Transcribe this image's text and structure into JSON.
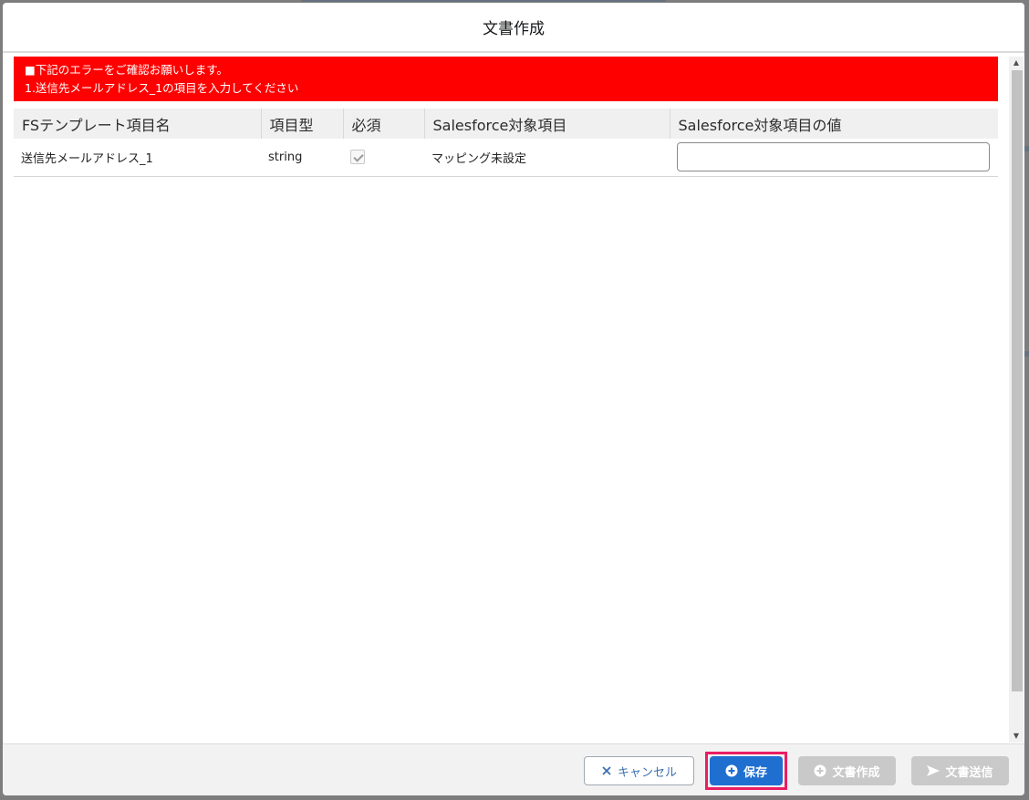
{
  "modal": {
    "title": "文書作成"
  },
  "error": {
    "line1": "■下記のエラーをご確認お願いします。",
    "line2": "1.送信先メールアドレス_1の項目を入力してください"
  },
  "table": {
    "headers": [
      "FSテンプレート項目名",
      "項目型",
      "必須",
      "Salesforce対象項目",
      "Salesforce対象項目の値"
    ],
    "rows": [
      {
        "field_name": "送信先メールアドレス_1",
        "type": "string",
        "required": true,
        "sf_field": "マッピング未設定",
        "value": ""
      }
    ]
  },
  "footer": {
    "cancel_label": "キャンセル",
    "save_label": "保存",
    "create_label": "文書作成",
    "send_label": "文書送信"
  },
  "icons": {
    "cancel": "close-icon",
    "save": "add-circle-icon",
    "create": "add-circle-icon",
    "send": "send-icon"
  },
  "colors": {
    "error_bg": "#ff0000",
    "primary": "#1f6fd1",
    "highlight": "#ea1e63",
    "disabled": "#c9c9c9"
  }
}
